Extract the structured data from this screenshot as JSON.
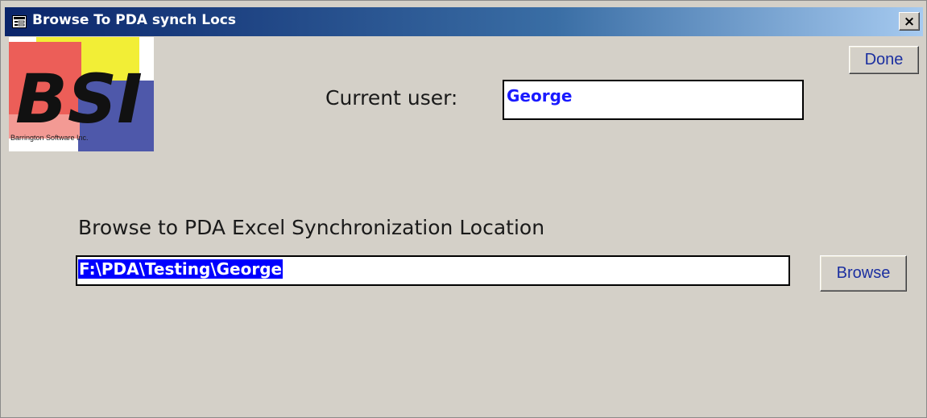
{
  "window": {
    "title": "Browse To PDA synch Locs",
    "close_label": "×"
  },
  "logo": {
    "text": "BSI",
    "subtitle": "Barrington Software Inc."
  },
  "toolbar": {
    "done_label": "Done",
    "browse_label": "Browse"
  },
  "user": {
    "label": "Current user:",
    "value": "George"
  },
  "sync_location": {
    "label": "Browse to PDA Excel Synchronization Location",
    "value": "F:\\PDA\\Testing\\George"
  },
  "colors": {
    "titlebar_start": "#0a246a",
    "titlebar_end": "#a6caf0",
    "window_bg": "#d4d0c8",
    "selection_bg": "#0000ff",
    "user_value_text": "#1a1aff",
    "button_text": "#1b2fa0"
  },
  "icons": {
    "title": "form-icon",
    "close": "close-icon"
  }
}
